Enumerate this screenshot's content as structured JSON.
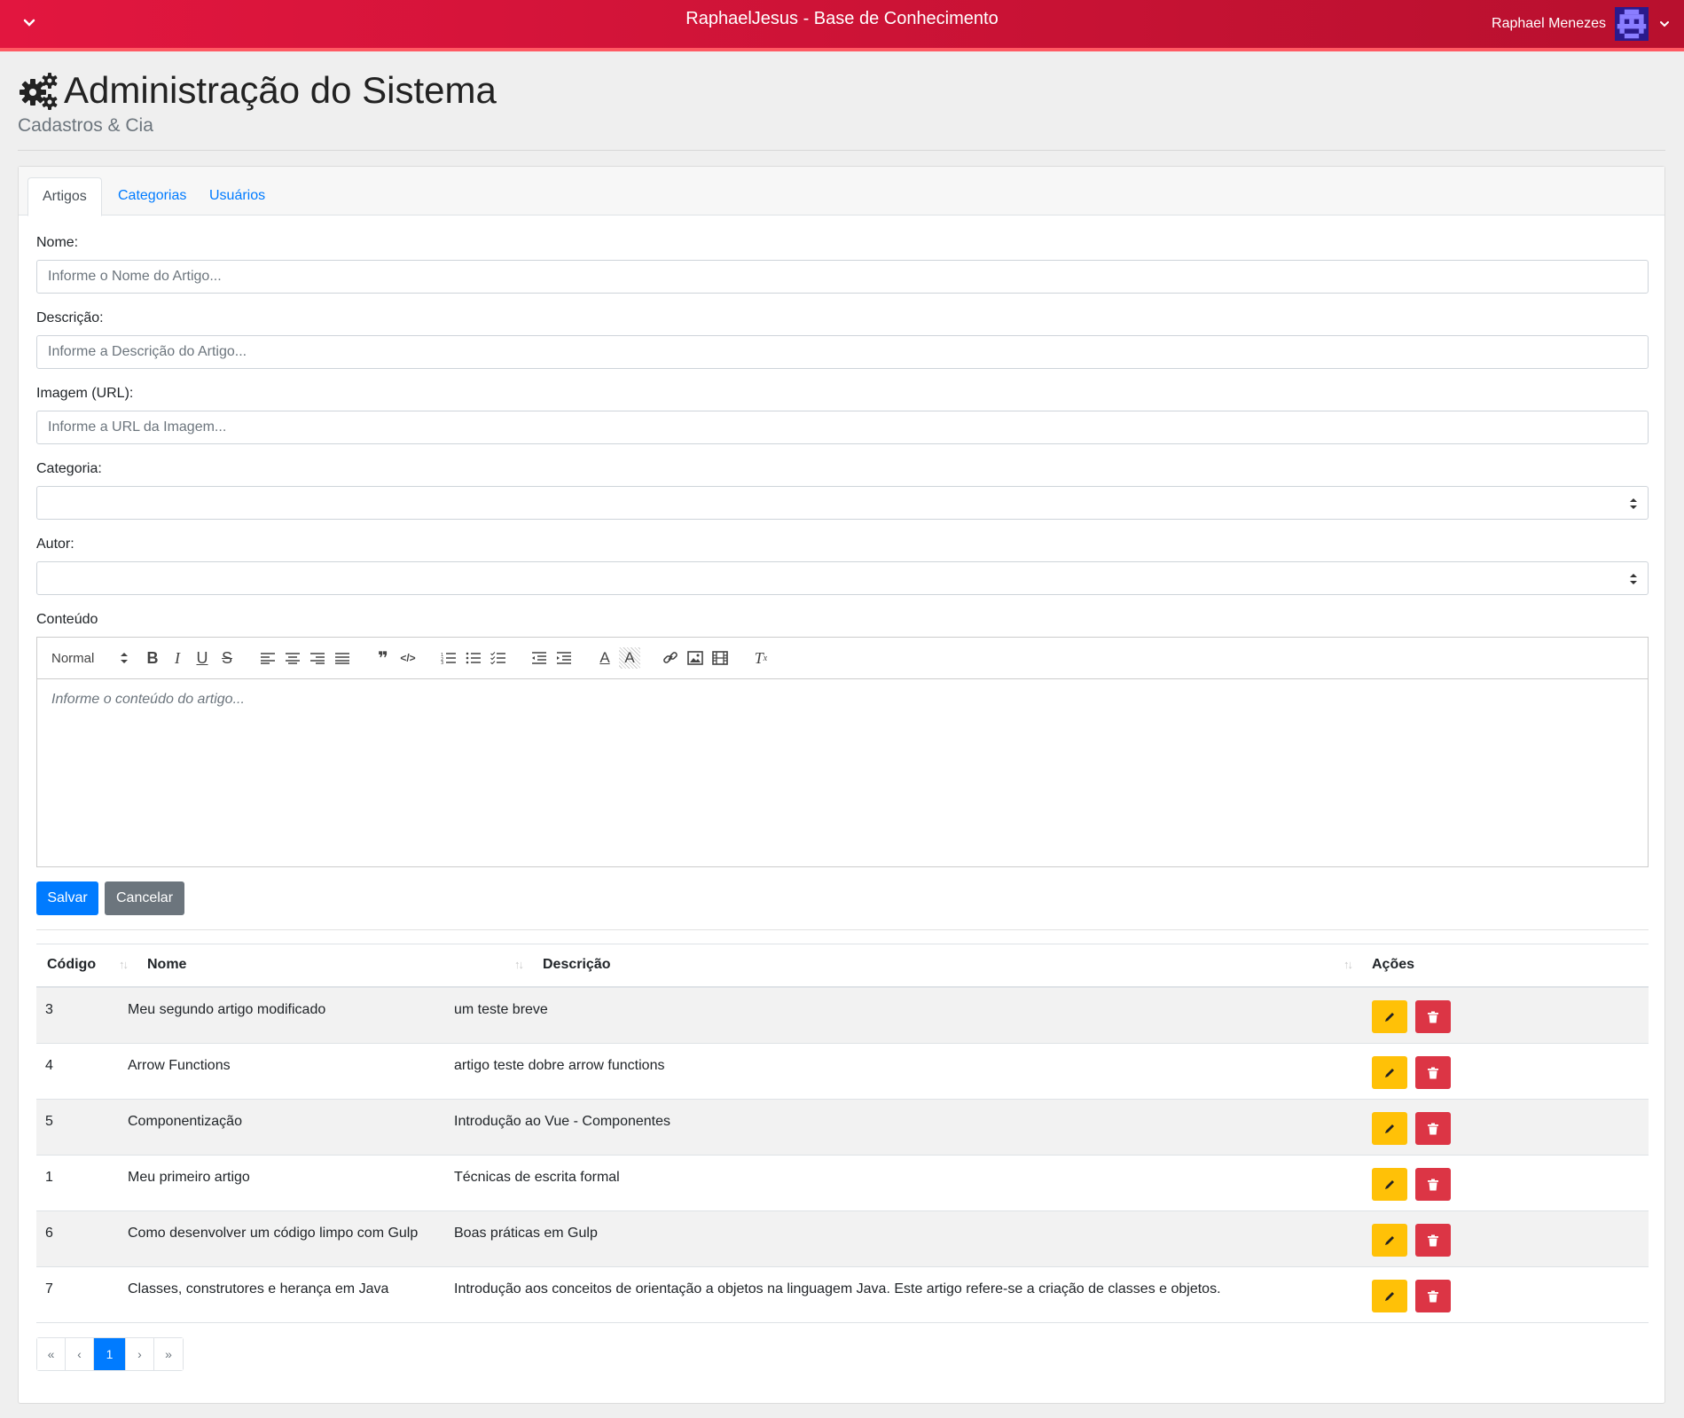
{
  "header": {
    "title": "RaphaelJesus - Base de Conhecimento",
    "user_name": "Raphael Menezes",
    "gradient_start": "#e2163f",
    "gradient_end": "#b8102e"
  },
  "page": {
    "title": "Administração do Sistema",
    "subtitle": "Cadastros & Cia"
  },
  "tabs": [
    {
      "label": "Artigos",
      "active": true
    },
    {
      "label": "Categorias",
      "active": false
    },
    {
      "label": "Usuários",
      "active": false
    }
  ],
  "form": {
    "name_label": "Nome:",
    "name_placeholder": "Informe o Nome do Artigo...",
    "description_label": "Descrição:",
    "description_placeholder": "Informe a Descrição do Artigo...",
    "image_label": "Imagem (URL):",
    "image_placeholder": "Informe a URL da Imagem...",
    "category_label": "Categoria:",
    "category_value": "",
    "author_label": "Autor:",
    "author_value": "",
    "content_label": "Conteúdo",
    "content_placeholder": "Informe o conteúdo do artigo...",
    "editor_format": "Normal",
    "save_label": "Salvar",
    "cancel_label": "Cancelar"
  },
  "table": {
    "headers": [
      "Código",
      "Nome",
      "Descrição",
      "Ações"
    ],
    "rows": [
      {
        "code": "3",
        "name": "Meu segundo artigo modificado",
        "description": "um teste breve"
      },
      {
        "code": "4",
        "name": "Arrow Functions",
        "description": "artigo teste dobre arrow functions"
      },
      {
        "code": "5",
        "name": "Componentização",
        "description": "Introdução ao Vue - Componentes"
      },
      {
        "code": "1",
        "name": "Meu primeiro artigo",
        "description": "Técnicas de escrita formal"
      },
      {
        "code": "6",
        "name": "Como desenvolver um código limpo com Gulp",
        "description": "Boas práticas em Gulp"
      },
      {
        "code": "7",
        "name": "Classes, construtores e herança em Java",
        "description": "Introdução aos conceitos de orientação a objetos na linguagem Java. Este artigo refere-se a criação de classes e objetos."
      }
    ]
  },
  "pagination": {
    "first": "«",
    "prev": "‹",
    "current": "1",
    "next": "›",
    "last": "»"
  },
  "colors": {
    "primary": "#007bff",
    "secondary": "#6c757d",
    "warning": "#ffc107",
    "danger": "#dc3545"
  }
}
